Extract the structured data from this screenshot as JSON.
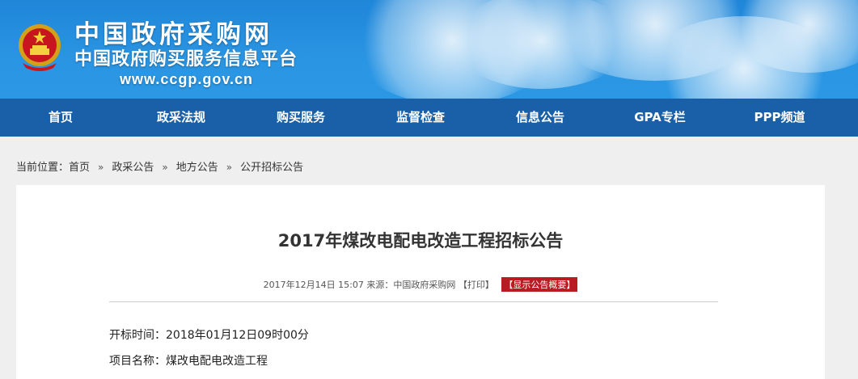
{
  "header": {
    "site_name": "中国政府采购网",
    "site_subtitle": "中国政府购买服务信息平台",
    "site_url": "www.ccgp.gov.cn",
    "emblem_icon": "national-emblem-icon",
    "colors": {
      "banner": "#2a95e3",
      "nav": "#1960a8",
      "badge": "#b81c22"
    }
  },
  "nav": {
    "items": [
      "首页",
      "政采法规",
      "购买服务",
      "监督检查",
      "信息公告",
      "GPA专栏",
      "PPP频道"
    ]
  },
  "breadcrumb": {
    "label": "当前位置：",
    "items": [
      "首页",
      "政采公告",
      "地方公告",
      "公开招标公告"
    ],
    "separator": "»"
  },
  "article": {
    "title": "2017年煤改电配电改造工程招标公告",
    "date": "2017年12月14日 15:07",
    "source": "来源：中国政府采购网",
    "print_label": "【打印】",
    "summary_label": "【显示公告概要】",
    "fields": {
      "open_time": "开标时间：2018年01月12日09时00分",
      "project_name": "项目名称：煤改电配电改造工程"
    }
  }
}
